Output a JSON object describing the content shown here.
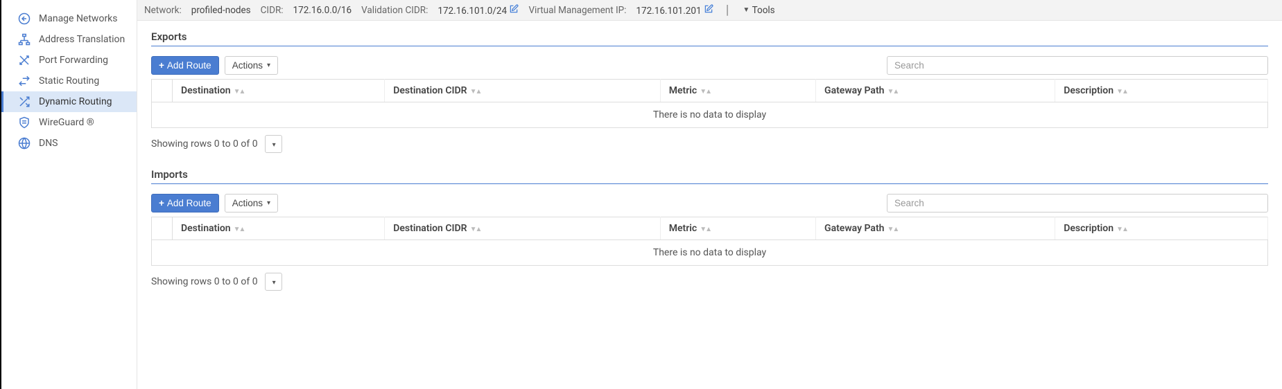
{
  "sidebar": {
    "items": [
      {
        "label": "Manage Networks"
      },
      {
        "label": "Address Translation"
      },
      {
        "label": "Port Forwarding"
      },
      {
        "label": "Static Routing"
      },
      {
        "label": "Dynamic Routing"
      },
      {
        "label": "WireGuard ®"
      },
      {
        "label": "DNS"
      }
    ]
  },
  "infobar": {
    "network_label": "Network:",
    "network_value": "profiled-nodes",
    "cidr_label": "CIDR:",
    "cidr_value": "172.16.0.0/16",
    "validation_cidr_label": "Validation CIDR:",
    "validation_cidr_value": "172.16.101.0/24",
    "vmip_label": "Virtual Management IP:",
    "vmip_value": "172.16.101.201",
    "tools_label": "Tools"
  },
  "buttons": {
    "add_route": "Add Route",
    "actions": "Actions"
  },
  "search": {
    "placeholder": "Search"
  },
  "columns": {
    "destination": "Destination",
    "destination_cidr": "Destination CIDR",
    "metric": "Metric",
    "gateway_path": "Gateway Path",
    "description": "Description"
  },
  "table": {
    "empty": "There is no data to display",
    "footer": "Showing rows 0 to 0 of 0"
  },
  "sections": {
    "exports": "Exports",
    "imports": "Imports"
  }
}
